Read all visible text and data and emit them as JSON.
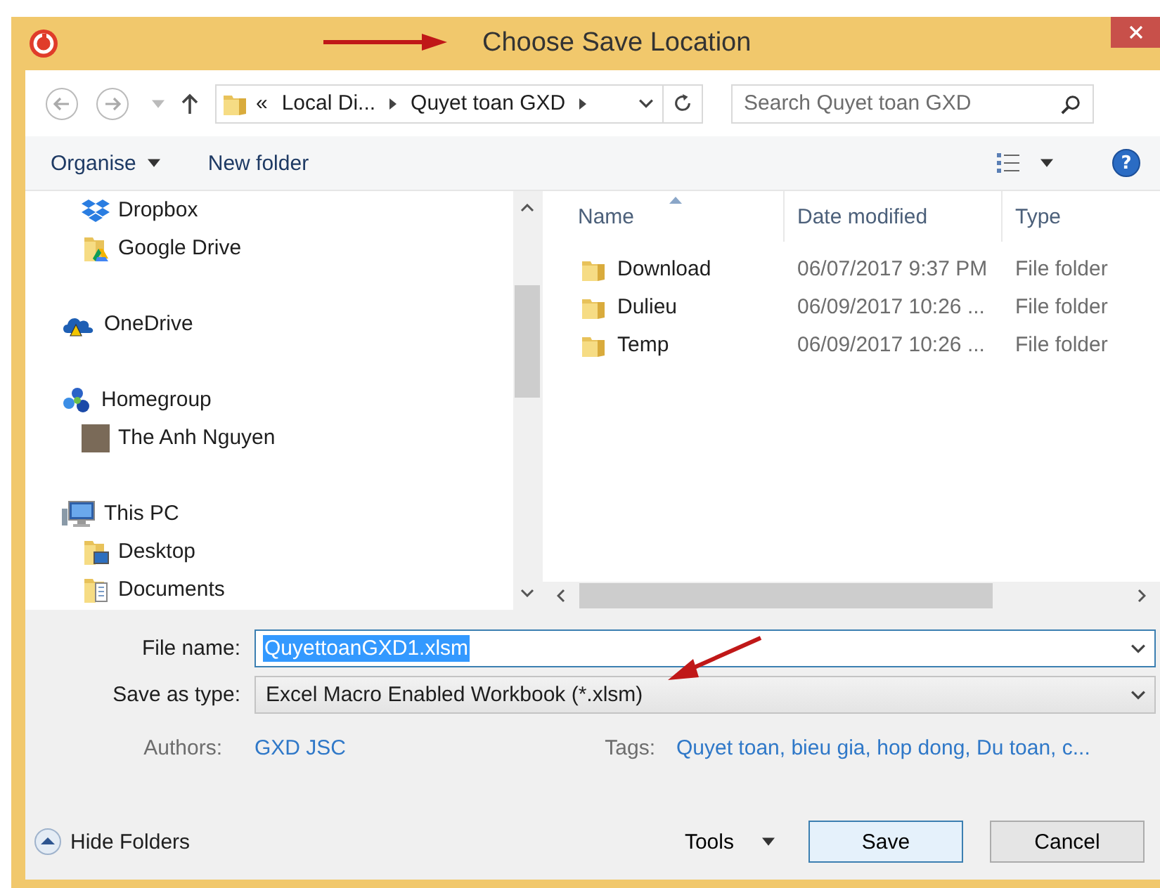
{
  "window": {
    "title": "Choose Save Location"
  },
  "address_bar": {
    "overflow": "«",
    "crumbs": [
      "Local Di...",
      "Quyet toan GXD"
    ],
    "search_placeholder": "Search Quyet toan GXD"
  },
  "toolbar": {
    "organise": "Organise",
    "new_folder": "New folder",
    "help": "?"
  },
  "nav_pane": [
    {
      "children": [
        {
          "label": "Dropbox",
          "kind": "dropbox"
        },
        {
          "label": "Google Drive",
          "kind": "drive"
        }
      ]
    },
    {
      "label": "OneDrive",
      "kind": "cloud"
    },
    {
      "label": "Homegroup",
      "kind": "homegroup",
      "children": [
        {
          "label": "The Anh Nguyen",
          "kind": "user"
        }
      ]
    },
    {
      "label": "This PC",
      "kind": "pc",
      "children": [
        {
          "label": "Desktop",
          "kind": "desktop"
        },
        {
          "label": "Documents",
          "kind": "documents"
        }
      ]
    }
  ],
  "file_list": {
    "columns": [
      "Name",
      "Date modified",
      "Type"
    ],
    "rows": [
      {
        "name": "Download",
        "date": "06/07/2017 9:37 PM",
        "type": "File folder"
      },
      {
        "name": "Dulieu",
        "date": "06/09/2017 10:26 ...",
        "type": "File folder"
      },
      {
        "name": "Temp",
        "date": "06/09/2017 10:26 ...",
        "type": "File folder"
      }
    ]
  },
  "form": {
    "file_name_label": "File name:",
    "file_name": "QuyettoanGXD1.xlsm",
    "file_name_selected": true,
    "save_type_label": "Save as type:",
    "save_type": "Excel Macro Enabled Workbook (*.xlsm)",
    "authors_label": "Authors:",
    "authors": "GXD JSC",
    "tags_label": "Tags:",
    "tags": "Quyet toan, bieu gia, hop dong, Du toan, c..."
  },
  "footer": {
    "hide_folders": "Hide Folders",
    "tools": "Tools",
    "save": "Save",
    "cancel": "Cancel"
  }
}
